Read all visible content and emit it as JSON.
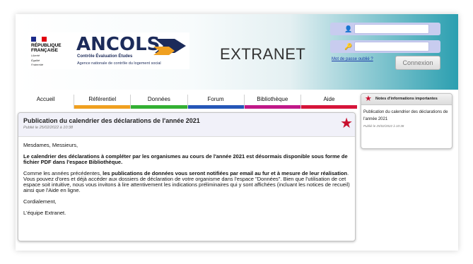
{
  "header": {
    "republique": [
      "RÉPUBLIQUE",
      "FRANÇAISE"
    ],
    "motto": [
      "Liberté",
      "Égalité",
      "Fraternité"
    ],
    "brand": "ANCOLS",
    "brand_sub1": "Contrôle Évaluation Études",
    "brand_sub2": "Agence nationale de contrôle du logement social",
    "app_title": "EXTRANET",
    "colors": {
      "brand": "#1c2b5a",
      "arrow_orange": "#f0a020",
      "arrow_blue": "#1c2b5a",
      "header_teal": "#2b9fb0"
    }
  },
  "login": {
    "user_icon": "user-icon",
    "key_icon": "key-icon",
    "forgot_label": "Mot de passe oublié ?",
    "submit_label": "Connexion"
  },
  "nav": {
    "items": [
      {
        "label": "Accueil",
        "color": "#ffffff"
      },
      {
        "label": "Référentiel",
        "color": "#f0a020"
      },
      {
        "label": "Données",
        "color": "#33b033"
      },
      {
        "label": "Forum",
        "color": "#2456b8"
      },
      {
        "label": "Bibliothèque",
        "color": "#c01888"
      },
      {
        "label": "Aide",
        "color": "#d6143a"
      }
    ]
  },
  "article": {
    "title": "Publication du calendrier des déclarations de l'année 2021",
    "date": "Publié le 25/02/2022 à 10:38",
    "greeting": "Mesdames, Messieurs,",
    "p1": "Le calendrier des déclarations à compléter par les organismes au cours de l'année 2021 est désormais disponible sous forme de fichier PDF dans l'espace Bibliothèque.",
    "p2_intro": "Comme les années précédentes, ",
    "p2_bold": "les publications de données vous seront notifiées par email au fur et à mesure de leur réalisation",
    "p2_rest": ". Vous pouvez d'ores et déjà accéder aux dossiers de déclaration de votre organisme dans l'espace \"Données\". Bien que l'utilisation de cet espace soit intuitive, nous vous invitons à lire attentivement les indications préliminaires qui y sont affichées (incluant les notices de recueil) ainsi que l'Aide en ligne.",
    "closing": "Cordialement,",
    "signature": "L'équipe Extranet."
  },
  "sidebar": {
    "title": "Notes d'informations importantes",
    "note_text": "Publication du calendrier des déclarations de l'année 2021",
    "note_date": "Publié le 25/02/2022 à 10:38"
  }
}
